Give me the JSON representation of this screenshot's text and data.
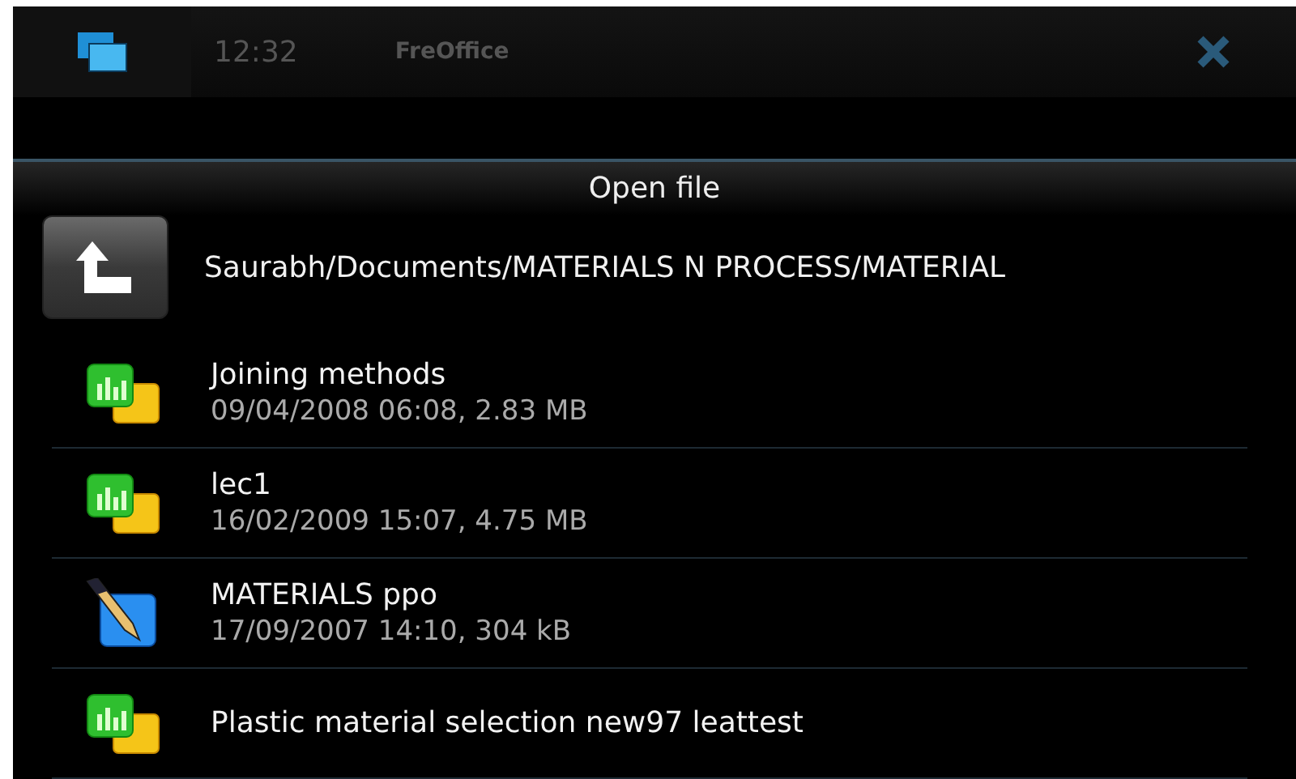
{
  "status_bar": {
    "time": "12:32",
    "app_title": "FreOffice"
  },
  "dialog": {
    "title": "Open file",
    "path": "Saurabh/Documents/MATERIALS N PROCESS/MATERIAL"
  },
  "files": [
    {
      "kind": "presentation",
      "name": "Joining methods",
      "details": "09/04/2008 06:08, 2.83 MB"
    },
    {
      "kind": "presentation",
      "name": "lec1",
      "details": "16/02/2009 15:07, 4.75 MB"
    },
    {
      "kind": "document",
      "name": "MATERIALS ppo",
      "details": "17/09/2007 14:10, 304 kB"
    },
    {
      "kind": "presentation",
      "name": "Plastic material selection new97 leattest"
    }
  ]
}
